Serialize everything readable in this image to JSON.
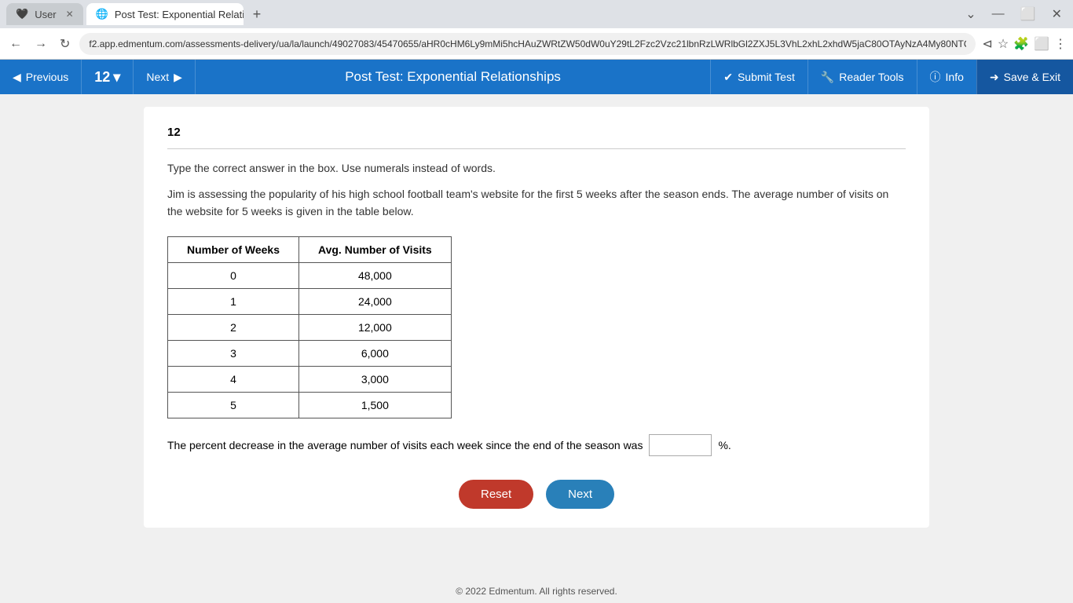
{
  "browser": {
    "tabs": [
      {
        "id": "user-tab",
        "label": "User",
        "icon": "user-icon",
        "active": false
      },
      {
        "id": "test-tab",
        "label": "Post Test: Exponential Relations",
        "icon": "globe-icon",
        "active": true
      }
    ],
    "new_tab_label": "+",
    "address": "f2.app.edmentum.com/assessments-delivery/ua/la/launch/49027083/45470655/aHR0cHM6Ly9mMi5hcHAuZWRtZW50dW0uY29tL2Fzc2Vzc21lbnRzLWRlbGl2ZXJ5L3VhL2xhL2xhdW5jaC80OTAyNzA4My80NTQ3MDY1NS9hSFIwY0hNNkx5OW1NaTVoY0hBdVpXUnRaVzUwZFcwdVkyOXRMMkZ6YzJWek1pNXhiWEEyTWk1a1dWbERKM..."
  },
  "header": {
    "previous_label": "Previous",
    "question_number": "12",
    "chevron": "▾",
    "next_label": "Next",
    "title": "Post Test: Exponential Relationships",
    "submit_label": "Submit Test",
    "reader_tools_label": "Reader Tools",
    "info_label": "Info",
    "save_exit_label": "Save & Exit"
  },
  "question": {
    "number": "12",
    "instructions": "Type the correct answer in the box. Use numerals instead of words.",
    "text": "Jim is assessing the popularity of his high school football team's website for the first 5 weeks after the season ends. The average number of visits on the website for 5 weeks is given in the table below.",
    "table": {
      "col1_header": "Number of Weeks",
      "col2_header": "Avg. Number of Visits",
      "rows": [
        {
          "weeks": "0",
          "visits": "48,000"
        },
        {
          "weeks": "1",
          "visits": "24,000"
        },
        {
          "weeks": "2",
          "visits": "12,000"
        },
        {
          "weeks": "3",
          "visits": "6,000"
        },
        {
          "weeks": "4",
          "visits": "3,000"
        },
        {
          "weeks": "5",
          "visits": "1,500"
        }
      ]
    },
    "answer_prefix": "The percent decrease in the average number of visits each week since the end of the season was",
    "answer_suffix": "%.",
    "answer_placeholder": ""
  },
  "buttons": {
    "reset_label": "Reset",
    "next_label": "Next"
  },
  "footer": {
    "text": "© 2022 Edmentum. All rights reserved."
  }
}
